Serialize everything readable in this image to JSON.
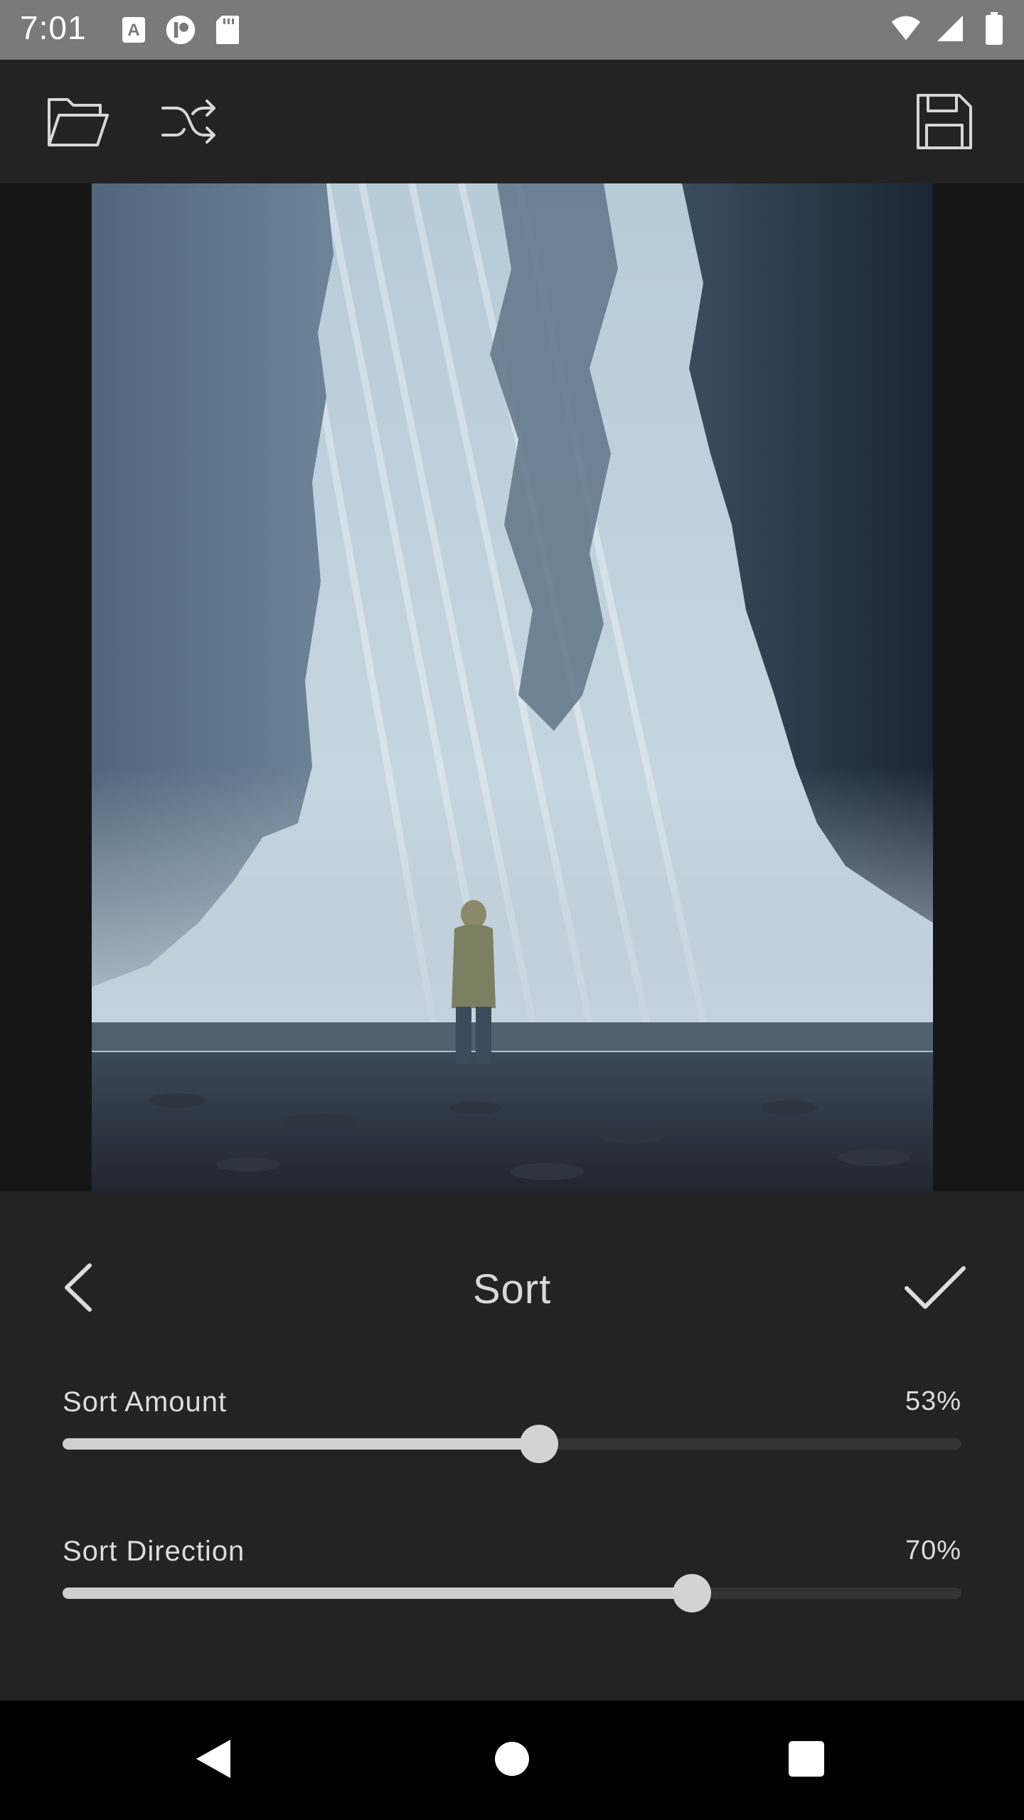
{
  "status_bar": {
    "time": "7:01",
    "left_icons": [
      "font-icon",
      "record-icon",
      "sd-card-icon"
    ],
    "right_icons": [
      "wifi-icon",
      "signal-icon",
      "battery-icon"
    ]
  },
  "toolbar": {
    "open_icon": "folder-open-icon",
    "shuffle_icon": "shuffle-icon",
    "save_icon": "floppy-save-icon"
  },
  "panel": {
    "title": "Sort",
    "back_icon": "chevron-left-icon",
    "apply_icon": "checkmark-icon",
    "sliders": [
      {
        "label": "Sort Amount",
        "value_text": "53%",
        "value": 0.53
      },
      {
        "label": "Sort Direction",
        "value_text": "70%",
        "value": 0.7
      }
    ]
  },
  "nav_bar": {
    "back_icon": "triangle-back-icon",
    "home_icon": "circle-home-icon",
    "recents_icon": "square-recents-icon"
  },
  "colors": {
    "status_bar": "#7a7a7a",
    "panel_bg": "#232323",
    "accent_light": "#cfcfcf"
  }
}
